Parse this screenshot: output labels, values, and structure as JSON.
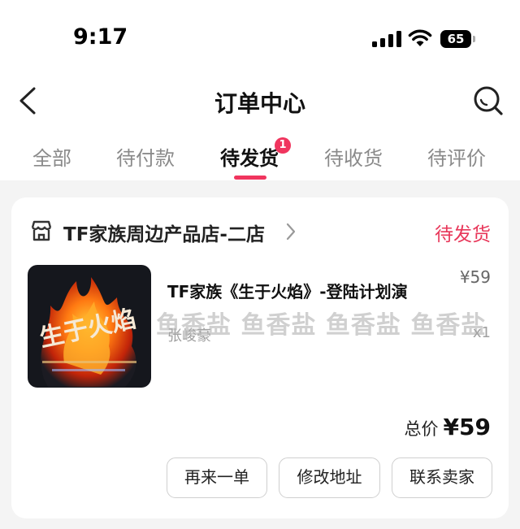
{
  "status_bar": {
    "time": "9:17",
    "battery": "65"
  },
  "nav": {
    "title": "订单中心"
  },
  "tabs": [
    {
      "label": "全部"
    },
    {
      "label": "待付款"
    },
    {
      "label": "待发货",
      "active": true,
      "badge": "1"
    },
    {
      "label": "待收货"
    },
    {
      "label": "待评价"
    }
  ],
  "order": {
    "store_name": "TF家族周边产品店-二店",
    "status": "待发货",
    "product_title": "TF家族《生于火焰》-登陆计划演",
    "price": "¥59",
    "variant": "张峻豪",
    "quantity": "x1",
    "watermark": "鱼香盐 鱼香盐 鱼香盐 鱼香盐",
    "thumbnail_text": "生于火焰",
    "total_label": "总价",
    "total_value": "¥59",
    "buttons": {
      "buy_again": "再来一单",
      "change_address": "修改地址",
      "contact_seller": "联系卖家"
    }
  },
  "colors": {
    "accent": "#f0355e",
    "status": "#e8375a"
  }
}
